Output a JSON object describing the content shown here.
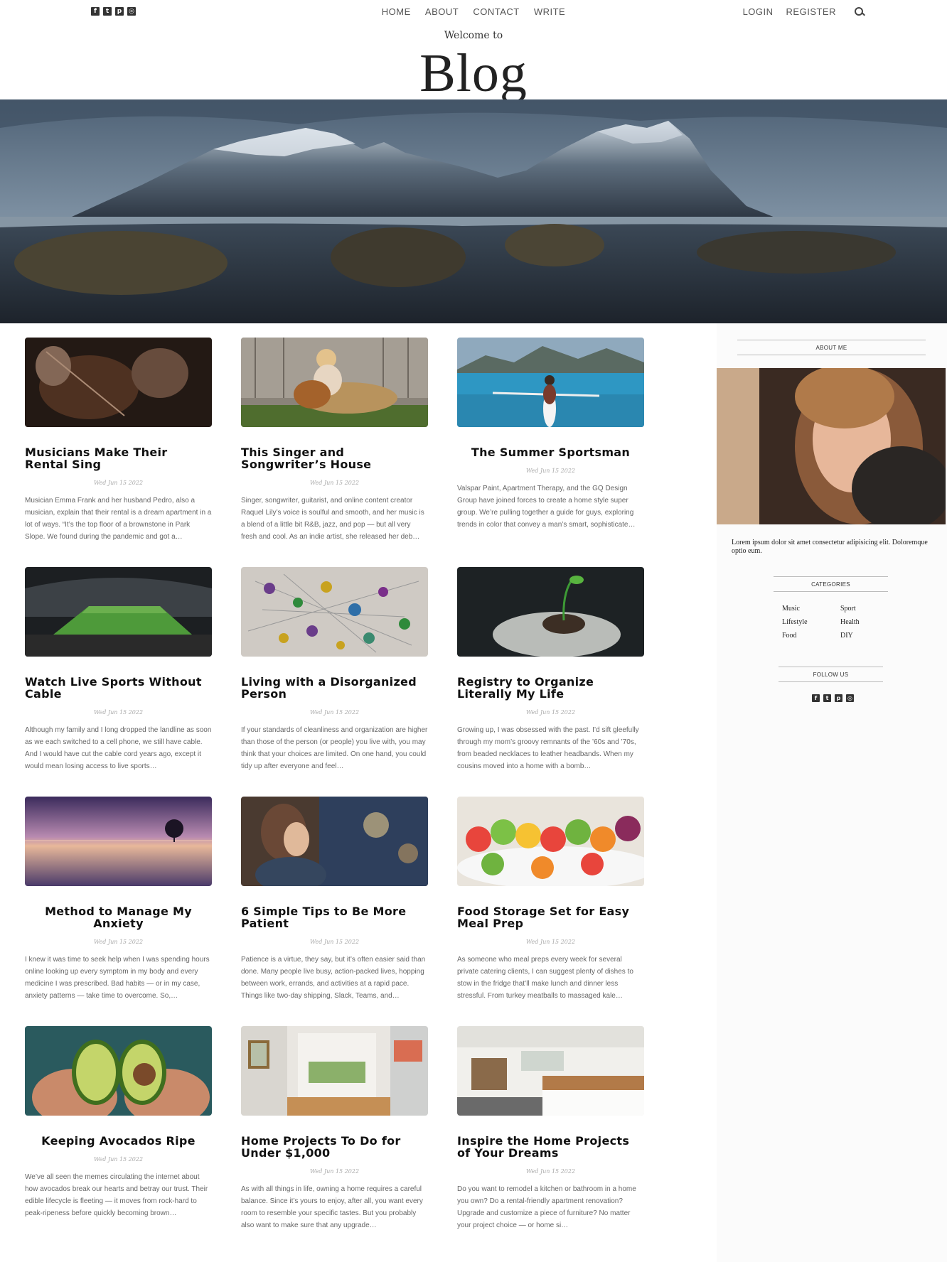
{
  "nav": {
    "social_icons": [
      "facebook-icon",
      "twitter-icon",
      "pinterest-icon",
      "instagram-icon"
    ],
    "center_links": [
      "HOME",
      "ABOUT",
      "CONTACT",
      "WRITE"
    ],
    "right_links": [
      "LOGIN",
      "REGISTER"
    ],
    "search_icon": "search-icon"
  },
  "header": {
    "welcome": "Welcome to",
    "title": "Blog"
  },
  "posts": [
    {
      "title": "Musicians Make Their Rental Sing",
      "date": "Wed Jun 15 2022",
      "excerpt": "Musician Emma Frank and her husband Pedro, also a musician, explain that their rental is a dream apartment in a lot of ways. “It’s the top floor of a brownstone in Park Slope. We found during the pandemic and got a…"
    },
    {
      "title": "This Singer and Songwriter’s House",
      "date": "Wed Jun 15 2022",
      "excerpt": "Singer, songwriter, guitarist, and online content creator Raquel Lily’s voice is soulful and smooth, and her music is a blend of a little bit R&B, jazz, and pop — but all very fresh and cool. As an indie artist, she released her deb…"
    },
    {
      "title": "The Summer Sportsman",
      "date": "Wed Jun 15 2022",
      "excerpt": "Valspar Paint, Apartment Therapy, and the GQ Design Group have joined forces to create a home style super group. We’re pulling together a guide for guys, exploring trends in color that convey a man’s smart, sophisticate…"
    },
    {
      "title": "Watch Live Sports Without Cable",
      "date": "Wed Jun 15 2022",
      "excerpt": "Although my family and I long dropped the landline as soon as we each switched to a cell phone, we still have cable. And I would have cut the cable cord years ago, except it would mean losing access to live sports…"
    },
    {
      "title": "Living with a Disorganized Person",
      "date": "Wed Jun 15 2022",
      "excerpt": "If your standards of cleanliness and organization are higher than those of the person (or people) you live with, you may think that your choices are limited. On one hand, you could tidy up after everyone and feel…"
    },
    {
      "title": "Registry to Organize Literally My Life",
      "date": "Wed Jun 15 2022",
      "excerpt": "Growing up, I was obsessed with the past. I’d sift gleefully through my mom’s groovy remnants of the ’60s and ’70s, from beaded necklaces to leather headbands. When my cousins moved into a home with a bomb…"
    },
    {
      "title": "Method to Manage My Anxiety",
      "date": "Wed Jun 15 2022",
      "excerpt": "I knew it was time to seek help when I was spending hours online looking up every symptom in my body and every medicine I was prescribed. Bad habits — or in my case, anxiety patterns — take time to overcome. So,…"
    },
    {
      "title": "6 Simple Tips to Be More Patient",
      "date": "Wed Jun 15 2022",
      "excerpt": "Patience is a virtue, they say, but it’s often easier said than done. Many people live busy, action-packed lives, hopping between work, errands, and activities at a rapid pace. Things like two-day shipping, Slack, Teams, and…"
    },
    {
      "title": "Food Storage Set for Easy Meal Prep",
      "date": "Wed Jun 15 2022",
      "excerpt": "As someone who meal preps every week for several private catering clients, I can suggest plenty of dishes to stow in the fridge that’ll make lunch and dinner less stressful. From turkey meatballs to massaged kale…"
    },
    {
      "title": "Keeping Avocados Ripe",
      "date": "Wed Jun 15 2022",
      "excerpt": "We’ve all seen the memes circulating the internet about how avocados break our hearts and betray our trust. Their edible lifecycle is fleeting — it moves from rock-hard to peak-ripeness before quickly becoming brown…"
    },
    {
      "title": "Home Projects To Do for Under $1,000",
      "date": "Wed Jun 15 2022",
      "excerpt": "As with all things in life, owning a home requires a careful balance. Since it’s yours to enjoy, after all, you want every room to resemble your specific tastes. But you probably also want to make sure that any upgrade…"
    },
    {
      "title": "Inspire the Home Projects of Your Dreams",
      "date": "Wed Jun 15 2022",
      "excerpt": "Do you want to remodel a kitchen or bathroom in a home you own? Do a rental-friendly apartment renovation? Upgrade and customize a piece of furniture? No matter your project choice — or home si…"
    }
  ],
  "sidebar": {
    "about_heading": "ABOUT ME",
    "about_text": "Lorem ipsum dolor sit amet consectetur adipisicing elit. Doloremque optio eum.",
    "categories_heading": "CATEGORIES",
    "categories": [
      "Music",
      "Sport",
      "Lifestyle",
      "Health",
      "Food",
      "DIY"
    ],
    "follow_heading": "FOLLOW US",
    "social_icons": [
      "facebook-icon",
      "twitter-icon",
      "pinterest-icon",
      "instagram-icon"
    ]
  }
}
